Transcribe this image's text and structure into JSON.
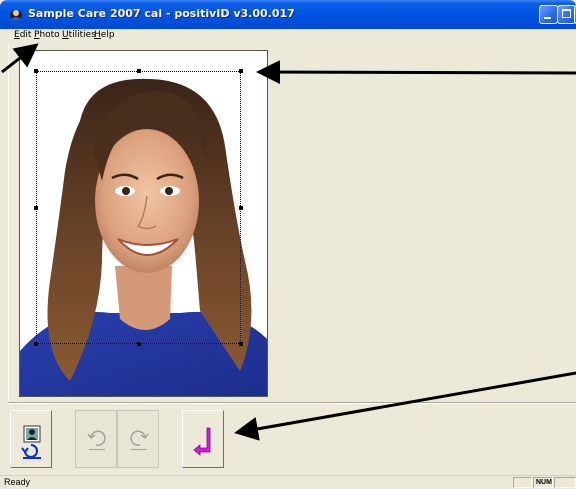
{
  "window": {
    "title": "Sample Care 2007 cal - positivID v3.00.017"
  },
  "menu": {
    "items": [
      "Edit",
      "Photo",
      "Utilities",
      "Help"
    ]
  },
  "toolbar": {
    "buttons": [
      {
        "name": "select-photo",
        "icon": "id-photo-icon",
        "enabled": true
      },
      {
        "name": "rotate-left",
        "icon": "rotate-left-icon",
        "enabled": false
      },
      {
        "name": "rotate-right",
        "icon": "rotate-right-icon",
        "enabled": false
      },
      {
        "name": "enter",
        "icon": "enter-arrow-icon",
        "enabled": true
      }
    ]
  },
  "status": {
    "text": "Ready",
    "indicator": "NUM"
  },
  "colors": {
    "titlebar": "#0054e3",
    "enter_arrow": "#d81bd8",
    "window_bg": "#ece9d8",
    "callout_arrow": "#000000"
  }
}
